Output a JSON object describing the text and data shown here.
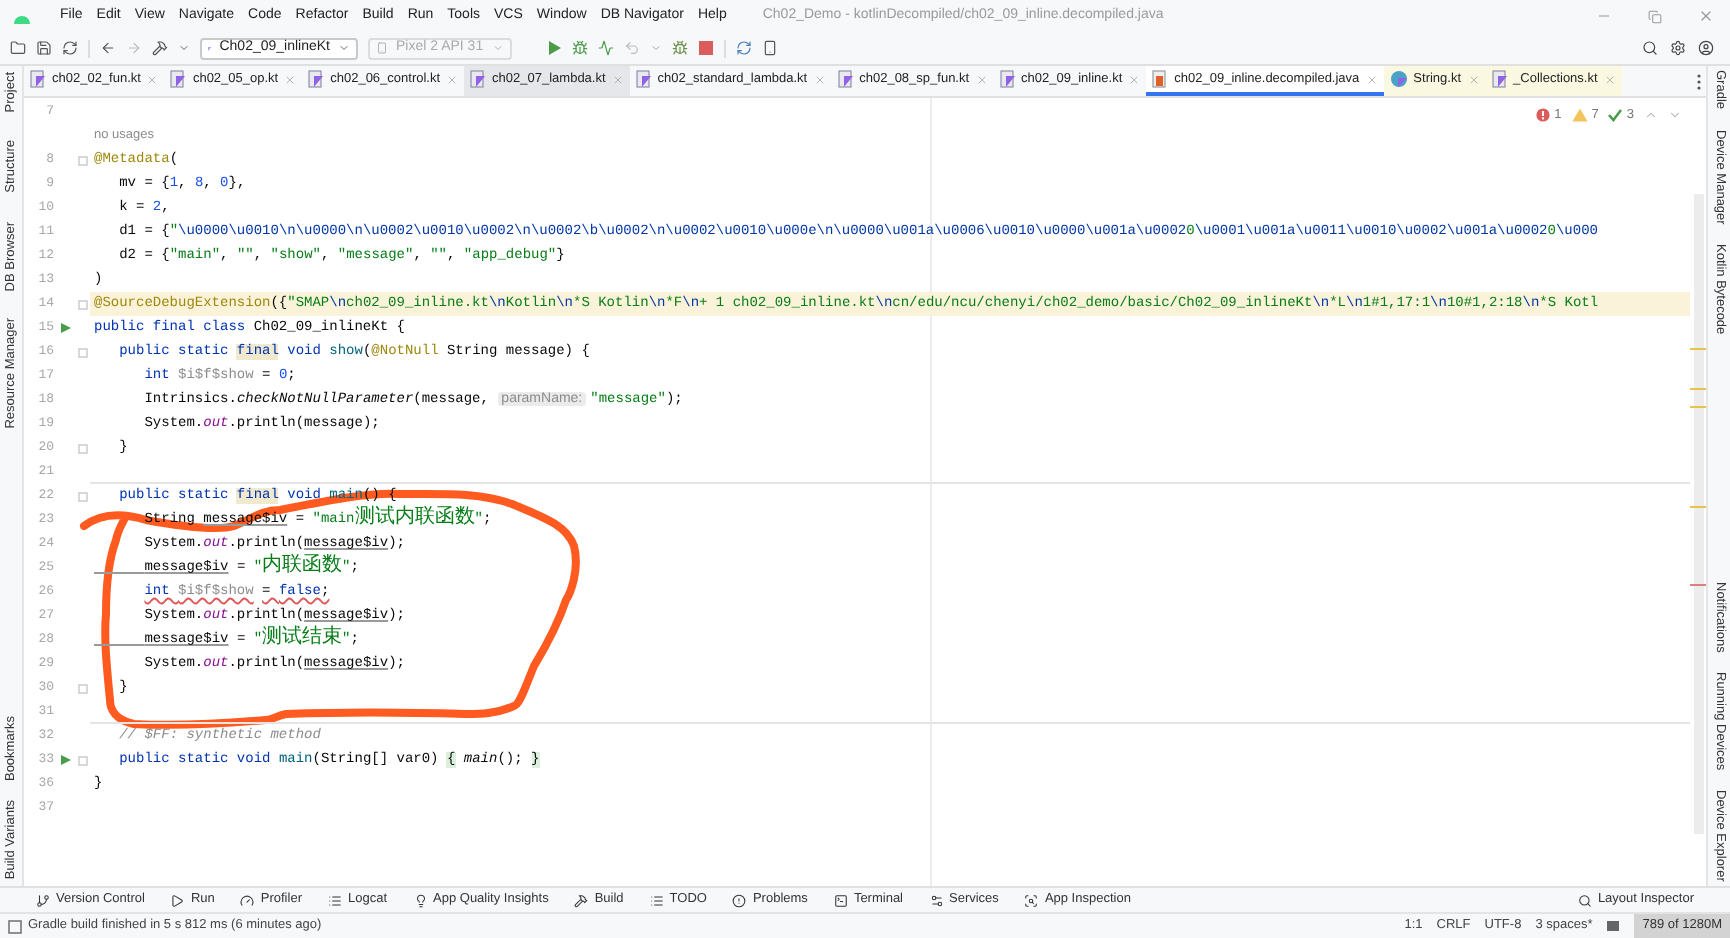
{
  "window": {
    "title": "Ch02_Demo - kotlinDecompiled/ch02_09_inline.decompiled.java"
  },
  "menu": [
    "File",
    "Edit",
    "View",
    "Navigate",
    "Code",
    "Refactor",
    "Build",
    "Run",
    "Tools",
    "VCS",
    "Window",
    "DB Navigator",
    "Help"
  ],
  "toolbar": {
    "run_config": "Ch02_09_inlineKt",
    "device": {
      "label": "Pixel 2 API 31",
      "disabled": true
    }
  },
  "tabs": [
    {
      "label": "ch02_02_fun.kt",
      "kind": "kotlin",
      "selected": false,
      "library": false,
      "hovered": false
    },
    {
      "label": "ch02_05_op.kt",
      "kind": "kotlin",
      "selected": false,
      "library": false,
      "hovered": false
    },
    {
      "label": "ch02_06_control.kt",
      "kind": "kotlin",
      "selected": false,
      "library": false,
      "hovered": false
    },
    {
      "label": "ch02_07_lambda.kt",
      "kind": "kotlin",
      "selected": false,
      "library": false,
      "hovered": true
    },
    {
      "label": "ch02_standard_lambda.kt",
      "kind": "kotlin",
      "selected": false,
      "library": false,
      "hovered": false
    },
    {
      "label": "ch02_08_sp_fun.kt",
      "kind": "kotlin",
      "selected": false,
      "library": false,
      "hovered": false
    },
    {
      "label": "ch02_09_inline.kt",
      "kind": "kotlin",
      "selected": false,
      "library": false,
      "hovered": false
    },
    {
      "label": "ch02_09_inline.decompiled.java",
      "kind": "java",
      "selected": true,
      "library": false,
      "hovered": false
    },
    {
      "label": "String.kt",
      "kind": "kotlin-class",
      "selected": false,
      "library": true,
      "hovered": false
    },
    {
      "label": "_Collections.kt",
      "kind": "kotlin",
      "selected": false,
      "library": true,
      "hovered": false
    }
  ],
  "left_tools": {
    "top": [
      "Project",
      "Structure",
      "DB Browser",
      "Resource Manager"
    ],
    "bottom": [
      "Bookmarks",
      "Build Variants"
    ]
  },
  "right_tools": {
    "top": [
      "Gradle",
      "Device Manager",
      "Kotlin Bytecode"
    ],
    "bottom": [
      "Notifications",
      "Running Devices",
      "Device Explorer"
    ]
  },
  "editor": {
    "inspections": [
      {
        "kind": "error",
        "count": "1"
      },
      {
        "kind": "warning",
        "count": "7"
      },
      {
        "kind": "typo",
        "count": "3"
      }
    ],
    "lines": [
      {
        "kind": "code",
        "number": "7"
      },
      {
        "kind": "inlay",
        "text": "no usages"
      },
      {
        "kind": "code",
        "number": "8",
        "fold": true,
        "tokens": [
          {
            "kind": "ann",
            "text": "@Metadata"
          },
          {
            "kind": "plain",
            "text": "("
          }
        ]
      },
      {
        "kind": "code",
        "number": "9",
        "tokens": [
          {
            "kind": "plain",
            "text": "   mv = {"
          },
          {
            "kind": "num",
            "text": "1"
          },
          {
            "kind": "plain",
            "text": ", "
          },
          {
            "kind": "num",
            "text": "8"
          },
          {
            "kind": "plain",
            "text": ", "
          },
          {
            "kind": "num",
            "text": "0"
          },
          {
            "kind": "plain",
            "text": "},"
          }
        ]
      },
      {
        "kind": "code",
        "number": "10",
        "tokens": [
          {
            "kind": "plain",
            "text": "   k = "
          },
          {
            "kind": "num",
            "text": "2"
          },
          {
            "kind": "plain",
            "text": ","
          }
        ]
      },
      {
        "kind": "code",
        "number": "11",
        "tokens": [
          {
            "kind": "plain",
            "text": "   d1 = {"
          },
          {
            "kind": "str",
            "text": "\""
          },
          {
            "kind": "esc",
            "text": "\\u0000\\u0010\\n\\u0000\\n\\u0002\\u0010\\u0002\\n\\u0002\\b\\u0002\\n\\u0002\\u0010\\u000e\\n\\u0000\\u001a\\u0006\\u0010\\u0000\\u001a\\u0002"
          },
          {
            "kind": "str",
            "text": "0"
          },
          {
            "kind": "esc",
            "text": "\\u0001\\u001a\\u0011\\u0010\\u0002\\u001a\\u0002"
          },
          {
            "kind": "str",
            "text": "0"
          },
          {
            "kind": "esc",
            "text": "\\u000"
          }
        ]
      },
      {
        "kind": "code",
        "number": "12",
        "tokens": [
          {
            "kind": "plain",
            "text": "   d2 = {"
          },
          {
            "kind": "str",
            "text": "\"main\""
          },
          {
            "kind": "plain",
            "text": ", "
          },
          {
            "kind": "str",
            "text": "\"\""
          },
          {
            "kind": "plain",
            "text": ", "
          },
          {
            "kind": "str",
            "text": "\"show\""
          },
          {
            "kind": "plain",
            "text": ", "
          },
          {
            "kind": "str",
            "text": "\"message\""
          },
          {
            "kind": "plain",
            "text": ", "
          },
          {
            "kind": "str",
            "text": "\"\""
          },
          {
            "kind": "plain",
            "text": ", "
          },
          {
            "kind": "str",
            "text": "\"app_debug\""
          },
          {
            "kind": "plain",
            "text": "}"
          }
        ]
      },
      {
        "kind": "code",
        "number": "13",
        "tokens": [
          {
            "kind": "plain",
            "text": ")"
          }
        ]
      },
      {
        "kind": "code",
        "number": "14",
        "fold": true,
        "highlighted": true,
        "tokens": [
          {
            "kind": "ann",
            "text": "@SourceDebugExtension"
          },
          {
            "kind": "plain",
            "text": "({"
          },
          {
            "kind": "str",
            "text": "\"SMAP"
          },
          {
            "kind": "esc",
            "text": "\\n"
          },
          {
            "kind": "str",
            "text": "ch02_09_inline.kt"
          },
          {
            "kind": "esc",
            "text": "\\n"
          },
          {
            "kind": "str",
            "text": "Kotlin"
          },
          {
            "kind": "esc",
            "text": "\\n"
          },
          {
            "kind": "str",
            "text": "*S Kotlin"
          },
          {
            "kind": "esc",
            "text": "\\n"
          },
          {
            "kind": "str",
            "text": "*F"
          },
          {
            "kind": "esc",
            "text": "\\n"
          },
          {
            "kind": "str",
            "text": "+ 1 ch02_09_inline.kt"
          },
          {
            "kind": "esc",
            "text": "\\n"
          },
          {
            "kind": "str",
            "text": "cn/edu/ncu/chenyi/ch02_demo/basic/Ch02_09_inlineKt"
          },
          {
            "kind": "esc",
            "text": "\\n"
          },
          {
            "kind": "str",
            "text": "*L"
          },
          {
            "kind": "esc",
            "text": "\\n"
          },
          {
            "kind": "str",
            "text": "1#1,17:1"
          },
          {
            "kind": "esc",
            "text": "\\n"
          },
          {
            "kind": "str",
            "text": "10#1,2:18"
          },
          {
            "kind": "esc",
            "text": "\\n"
          },
          {
            "kind": "str",
            "text": "*S Kotl"
          }
        ]
      },
      {
        "kind": "code",
        "number": "15",
        "run": true,
        "tokens": [
          {
            "kind": "kw",
            "text": "public final class "
          },
          {
            "kind": "plain",
            "text": "Ch02_09_inlineKt {"
          }
        ]
      },
      {
        "kind": "code",
        "number": "16",
        "fold": true,
        "tokens": [
          {
            "kind": "kw",
            "text": "   public static "
          },
          {
            "kind": "final",
            "text": "final"
          },
          {
            "kind": "kw",
            "text": " void "
          },
          {
            "kind": "decl",
            "text": "show"
          },
          {
            "kind": "plain",
            "text": "("
          },
          {
            "kind": "ann",
            "text": "@NotNull"
          },
          {
            "kind": "plain",
            "text": " String message) {"
          }
        ]
      },
      {
        "kind": "code",
        "number": "17",
        "tokens": [
          {
            "kind": "kw",
            "text": "      int "
          },
          {
            "kind": "unused",
            "text": "$i$f$show"
          },
          {
            "kind": "plain",
            "text": " = "
          },
          {
            "kind": "num",
            "text": "0"
          },
          {
            "kind": "plain",
            "text": ";"
          }
        ]
      },
      {
        "kind": "code",
        "number": "18",
        "tokens": [
          {
            "kind": "plain",
            "text": "      Intrinsics."
          },
          {
            "kind": "ital",
            "text": "checkNotNullParameter"
          },
          {
            "kind": "plain",
            "text": "(message, "
          },
          {
            "kind": "hint",
            "text": "paramName:"
          },
          {
            "kind": "str",
            "text": "\"message\""
          },
          {
            "kind": "plain",
            "text": ");"
          }
        ]
      },
      {
        "kind": "code",
        "number": "19",
        "tokens": [
          {
            "kind": "plain",
            "text": "      System."
          },
          {
            "kind": "field",
            "text": "out"
          },
          {
            "kind": "plain",
            "text": ".println(message);"
          }
        ]
      },
      {
        "kind": "code",
        "number": "20",
        "fold": true,
        "tokens": [
          {
            "kind": "plain",
            "text": "   }"
          }
        ]
      },
      {
        "kind": "code",
        "number": "21",
        "separator": true
      },
      {
        "kind": "code",
        "number": "22",
        "fold": true,
        "tokens": [
          {
            "kind": "kw",
            "text": "   public static "
          },
          {
            "kind": "final",
            "text": "final"
          },
          {
            "kind": "kw",
            "text": " void "
          },
          {
            "kind": "decl",
            "text": "main"
          },
          {
            "kind": "plain",
            "text": "() {"
          }
        ]
      },
      {
        "kind": "code",
        "number": "23",
        "tokens": [
          {
            "kind": "plain",
            "text": "      String "
          },
          {
            "kind": "var",
            "text": "message$iv"
          },
          {
            "kind": "plain",
            "text": " = "
          },
          {
            "kind": "str",
            "text": "\"main测试内联函数\""
          },
          {
            "kind": "plain",
            "text": ";"
          }
        ]
      },
      {
        "kind": "code",
        "number": "24",
        "tokens": [
          {
            "kind": "plain",
            "text": "      System."
          },
          {
            "kind": "field",
            "text": "out"
          },
          {
            "kind": "plain",
            "text": ".println("
          },
          {
            "kind": "var",
            "text": "message$iv"
          },
          {
            "kind": "plain",
            "text": ");"
          }
        ]
      },
      {
        "kind": "code",
        "number": "25",
        "tokens": [
          {
            "kind": "var",
            "text": "      message$iv"
          },
          {
            "kind": "plain",
            "text": " = "
          },
          {
            "kind": "str",
            "text": "\"内联函数\""
          },
          {
            "kind": "plain",
            "text": ";"
          }
        ]
      },
      {
        "kind": "code",
        "number": "26",
        "error": true,
        "tokens": [
          {
            "kind": "kw",
            "text": "      int "
          },
          {
            "kind": "unused",
            "text": "$i$f$show"
          },
          {
            "kind": "plain",
            "text": " = "
          },
          {
            "kind": "kw",
            "text": "false"
          },
          {
            "kind": "plain",
            "text": ";"
          }
        ]
      },
      {
        "kind": "code",
        "number": "27",
        "tokens": [
          {
            "kind": "plain",
            "text": "      System."
          },
          {
            "kind": "field",
            "text": "out"
          },
          {
            "kind": "plain",
            "text": ".println("
          },
          {
            "kind": "var",
            "text": "message$iv"
          },
          {
            "kind": "plain",
            "text": ");"
          }
        ]
      },
      {
        "kind": "code",
        "number": "28",
        "tokens": [
          {
            "kind": "var",
            "text": "      message$iv"
          },
          {
            "kind": "plain",
            "text": " = "
          },
          {
            "kind": "str",
            "text": "\"测试结束\""
          },
          {
            "kind": "plain",
            "text": ";"
          }
        ]
      },
      {
        "kind": "code",
        "number": "29",
        "tokens": [
          {
            "kind": "plain",
            "text": "      System."
          },
          {
            "kind": "field",
            "text": "out"
          },
          {
            "kind": "plain",
            "text": ".println("
          },
          {
            "kind": "var",
            "text": "message$iv"
          },
          {
            "kind": "plain",
            "text": ");"
          }
        ]
      },
      {
        "kind": "code",
        "number": "30",
        "fold": true,
        "tokens": [
          {
            "kind": "plain",
            "text": "   }"
          }
        ]
      },
      {
        "kind": "code",
        "number": "31",
        "separator": true
      },
      {
        "kind": "code",
        "number": "32",
        "tokens": [
          {
            "kind": "comment",
            "text": "   // $FF: synthetic method"
          }
        ]
      },
      {
        "kind": "code",
        "number": "33",
        "run": true,
        "fold": true,
        "tokens": [
          {
            "kind": "kw",
            "text": "   public static void "
          },
          {
            "kind": "decl",
            "text": "main"
          },
          {
            "kind": "plain",
            "text": "(String[] var0) "
          },
          {
            "kind": "brace",
            "text": "{"
          },
          {
            "kind": "ital",
            "text": " main"
          },
          {
            "kind": "plain",
            "text": "(); "
          },
          {
            "kind": "brace",
            "text": "}"
          }
        ]
      },
      {
        "kind": "code",
        "number": "36",
        "tokens": [
          {
            "kind": "plain",
            "text": "}"
          }
        ]
      },
      {
        "kind": "code",
        "number": "37"
      }
    ]
  },
  "tool_windows": {
    "left": [
      {
        "kind": "vcs",
        "label": "Version Control"
      },
      {
        "kind": "run",
        "label": "Run"
      },
      {
        "kind": "profiler",
        "label": "Profiler"
      },
      {
        "kind": "logcat",
        "label": "Logcat"
      },
      {
        "kind": "insights",
        "label": "App Quality Insights"
      },
      {
        "kind": "build",
        "label": "Build"
      },
      {
        "kind": "todo",
        "label": "TODO"
      },
      {
        "kind": "problems",
        "label": "Problems"
      },
      {
        "kind": "terminal",
        "label": "Terminal"
      },
      {
        "kind": "services",
        "label": "Services"
      },
      {
        "kind": "inspection",
        "label": "App Inspection"
      }
    ],
    "right": [
      {
        "kind": "layout",
        "label": "Layout Inspector"
      }
    ]
  },
  "status_bar": {
    "message": "Gradle build finished in 5 s 812 ms (6 minutes ago)",
    "items": [
      "1:1",
      "CRLF",
      "UTF-8",
      "3 spaces*"
    ],
    "memory": "789 of 1280M"
  }
}
